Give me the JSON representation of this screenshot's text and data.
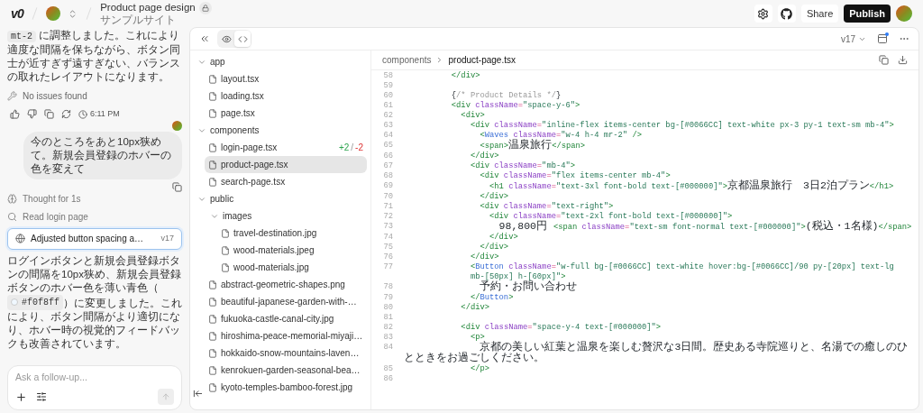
{
  "header": {
    "logo": "v0",
    "project_title": "Product page design",
    "subtitle": "サンプルサイト"
  },
  "top_actions": {
    "share": "Share",
    "publish": "Publish"
  },
  "chat": {
    "reply_segments": [
      {
        "kind": "code",
        "text": "mt-2"
      },
      {
        "kind": "text",
        "text": " に調整しました。これにより適度な間隔を保ちながら、ボタン同士が近すぎず遠すぎない、バランスの取れたレイアウトになります。"
      }
    ],
    "status": "No issues found",
    "time": "6:11 PM",
    "user_message": "今のところをあと10px狭めて。新規会員登録のホバーの色を変えて",
    "steps": [
      {
        "kind": "thought",
        "label": "Thought for 1s"
      },
      {
        "kind": "search",
        "label": "Read login page"
      }
    ],
    "version_card": {
      "title": "Adjusted button spacing a…",
      "version": "v17"
    },
    "final_segments": [
      {
        "kind": "text",
        "text": "ログインボタンと新規会員登録ボタンの間隔を10px狭め、新規会員登録ボタンのホバー色を薄い青色（"
      },
      {
        "kind": "color_code",
        "text": "#f0f8ff",
        "color": "#f0f8ff"
      },
      {
        "kind": "text",
        "text": "）に変更しました。これにより、ボタン間隔がより適切になり、ホバー時の視覚的フィードバックも改善されています。"
      }
    ],
    "input": {
      "placeholder": "Ask a follow-up..."
    }
  },
  "editor": {
    "version": "v17",
    "view_tabs": [
      {
        "kind": "preview",
        "selected": false
      },
      {
        "kind": "code",
        "selected": true
      }
    ],
    "tree": [
      {
        "kind": "folder",
        "name": "app",
        "expanded": true,
        "children": [
          {
            "kind": "file",
            "name": "layout.tsx",
            "selected": false
          },
          {
            "kind": "file",
            "name": "loading.tsx",
            "selected": false
          },
          {
            "kind": "file",
            "name": "page.tsx",
            "selected": false
          }
        ]
      },
      {
        "kind": "folder",
        "name": "components",
        "expanded": true,
        "children": [
          {
            "kind": "file",
            "name": "login-page.tsx",
            "selected": false,
            "diff": {
              "added": "+2",
              "sep": "/",
              "removed": "-2"
            }
          },
          {
            "kind": "file",
            "name": "product-page.tsx",
            "selected": true
          },
          {
            "kind": "file",
            "name": "search-page.tsx",
            "selected": false
          }
        ]
      },
      {
        "kind": "folder",
        "name": "public",
        "expanded": true,
        "children": [
          {
            "kind": "folder",
            "name": "images",
            "expanded": true,
            "children": [
              {
                "kind": "file",
                "name": "travel-destination.jpg",
                "selected": false
              },
              {
                "kind": "file",
                "name": "wood-materials.jpeg",
                "selected": false
              },
              {
                "kind": "file",
                "name": "wood-materials.jpg",
                "selected": false
              }
            ]
          },
          {
            "kind": "file",
            "name": "abstract-geometric-shapes.png",
            "selected": false
          },
          {
            "kind": "file",
            "name": "beautiful-japanese-garden-with-…",
            "selected": false
          },
          {
            "kind": "file",
            "name": "fukuoka-castle-canal-city.jpg",
            "selected": false
          },
          {
            "kind": "file",
            "name": "hiroshima-peace-memorial-miyaji…",
            "selected": false
          },
          {
            "kind": "file",
            "name": "hokkaido-snow-mountains-laven…",
            "selected": false
          },
          {
            "kind": "file",
            "name": "kenrokuen-garden-seasonal-bea…",
            "selected": false
          },
          {
            "kind": "file",
            "name": "kyoto-temples-bamboo-forest.jpg",
            "selected": false
          }
        ]
      }
    ],
    "breadcrumb": [
      "components",
      "product-page.tsx"
    ],
    "lines": [
      {
        "num": "58",
        "tokens": [
          {
            "kind": "tag",
            "text": "          </div>"
          }
        ]
      },
      {
        "num": "59"
      },
      {
        "num": "60",
        "tokens": [
          {
            "kind": "text",
            "text": "          {"
          },
          {
            "kind": "comment",
            "text": "/* Product Details */"
          },
          {
            "kind": "text",
            "text": "}"
          }
        ]
      },
      {
        "num": "61",
        "tokens": [
          {
            "kind": "tag",
            "text": "          <div"
          },
          {
            "kind": "attr",
            "text": " className"
          },
          {
            "kind": "eq",
            "text": "="
          },
          {
            "kind": "str",
            "text": "\"space-y-6\""
          },
          {
            "kind": "tag",
            "text": ">"
          }
        ]
      },
      {
        "num": "62",
        "tokens": [
          {
            "kind": "tag",
            "text": "            <div>"
          }
        ]
      },
      {
        "num": "63",
        "tokens": [
          {
            "kind": "tag",
            "text": "              <div"
          },
          {
            "kind": "attr",
            "text": " className"
          },
          {
            "kind": "eq",
            "text": "="
          },
          {
            "kind": "str",
            "text": "\"inline-flex items-center bg-[#0066CC] text-white px-3 py-1 text-sm mb-4\""
          },
          {
            "kind": "tag",
            "text": ">"
          }
        ]
      },
      {
        "num": "64",
        "tokens": [
          {
            "kind": "tag",
            "text": "                <"
          },
          {
            "kind": "comp",
            "text": "Waves"
          },
          {
            "kind": "attr",
            "text": " className"
          },
          {
            "kind": "eq",
            "text": "="
          },
          {
            "kind": "str",
            "text": "\"w-4 h-4 mr-2\""
          },
          {
            "kind": "tag",
            "text": " />"
          }
        ]
      },
      {
        "num": "65",
        "tokens": [
          {
            "kind": "tag",
            "text": "                <span>"
          },
          {
            "kind": "jp",
            "text": "温泉旅行"
          },
          {
            "kind": "tag",
            "text": "</span>"
          }
        ]
      },
      {
        "num": "66",
        "tokens": [
          {
            "kind": "tag",
            "text": "              </div>"
          }
        ]
      },
      {
        "num": "67",
        "tokens": [
          {
            "kind": "tag",
            "text": "              <div"
          },
          {
            "kind": "attr",
            "text": " className"
          },
          {
            "kind": "eq",
            "text": "="
          },
          {
            "kind": "str",
            "text": "\"mb-4\""
          },
          {
            "kind": "tag",
            "text": ">"
          }
        ]
      },
      {
        "num": "68",
        "tokens": [
          {
            "kind": "tag",
            "text": "                <div"
          },
          {
            "kind": "attr",
            "text": " className"
          },
          {
            "kind": "eq",
            "text": "="
          },
          {
            "kind": "str",
            "text": "\"flex items-center mb-4\""
          },
          {
            "kind": "tag",
            "text": ">"
          }
        ]
      },
      {
        "num": "69",
        "tokens": [
          {
            "kind": "tag",
            "text": "                  <h1"
          },
          {
            "kind": "attr",
            "text": " className"
          },
          {
            "kind": "eq",
            "text": "="
          },
          {
            "kind": "str",
            "text": "\"text-3xl font-bold text-[#000000]\""
          },
          {
            "kind": "tag",
            "text": ">"
          },
          {
            "kind": "jp",
            "text": "京都温泉旅行　3日2泊プラン"
          },
          {
            "kind": "tag",
            "text": "</h1>"
          }
        ]
      },
      {
        "num": "70",
        "tokens": [
          {
            "kind": "tag",
            "text": "                </div>"
          }
        ]
      },
      {
        "num": "71",
        "tokens": [
          {
            "kind": "tag",
            "text": "                <div"
          },
          {
            "kind": "attr",
            "text": " className"
          },
          {
            "kind": "eq",
            "text": "="
          },
          {
            "kind": "str",
            "text": "\"text-right\""
          },
          {
            "kind": "tag",
            "text": ">"
          }
        ]
      },
      {
        "num": "72",
        "tokens": [
          {
            "kind": "tag",
            "text": "                  <div"
          },
          {
            "kind": "attr",
            "text": " className"
          },
          {
            "kind": "eq",
            "text": "="
          },
          {
            "kind": "str",
            "text": "\"text-2xl font-bold text-[#000000]\""
          },
          {
            "kind": "tag",
            "text": ">"
          }
        ]
      },
      {
        "num": "73",
        "tokens": [
          {
            "kind": "jp",
            "text": "                    98,800円 "
          },
          {
            "kind": "tag",
            "text": "<span"
          },
          {
            "kind": "attr",
            "text": " className"
          },
          {
            "kind": "eq",
            "text": "="
          },
          {
            "kind": "str",
            "text": "\"text-sm font-normal text-[#000000]\""
          },
          {
            "kind": "tag",
            "text": ">"
          },
          {
            "kind": "jp",
            "text": "(税込・1名様)"
          },
          {
            "kind": "tag",
            "text": "</span>"
          }
        ]
      },
      {
        "num": "74",
        "tokens": [
          {
            "kind": "tag",
            "text": "                  </div>"
          }
        ]
      },
      {
        "num": "75",
        "tokens": [
          {
            "kind": "tag",
            "text": "                </div>"
          }
        ]
      },
      {
        "num": "76",
        "tokens": [
          {
            "kind": "tag",
            "text": "              </div>"
          }
        ]
      },
      {
        "num": "77",
        "tokens": [
          {
            "kind": "tag",
            "text": "              <"
          },
          {
            "kind": "comp",
            "text": "Button"
          },
          {
            "kind": "attr",
            "text": " className"
          },
          {
            "kind": "eq",
            "text": "="
          },
          {
            "kind": "str",
            "text": "\"w-full bg-[#0066CC] text-white hover:bg-[#0066CC]/90 py-[20px] text-lg"
          }
        ]
      },
      {
        "tokens": [
          {
            "kind": "str",
            "text": "              mb-[50px] h-[60px]\""
          },
          {
            "kind": "tag",
            "text": ">"
          }
        ]
      },
      {
        "num": "78",
        "tokens": [
          {
            "kind": "jp",
            "text": "                予約・お問い合わせ"
          }
        ]
      },
      {
        "num": "79",
        "tokens": [
          {
            "kind": "tag",
            "text": "              </"
          },
          {
            "kind": "comp",
            "text": "Button"
          },
          {
            "kind": "tag",
            "text": ">"
          }
        ]
      },
      {
        "num": "80",
        "tokens": [
          {
            "kind": "tag",
            "text": "            </div>"
          }
        ]
      },
      {
        "num": "81"
      },
      {
        "num": "82",
        "tokens": [
          {
            "kind": "tag",
            "text": "            <div"
          },
          {
            "kind": "attr",
            "text": " className"
          },
          {
            "kind": "eq",
            "text": "="
          },
          {
            "kind": "str",
            "text": "\"space-y-4 text-[#000000]\""
          },
          {
            "kind": "tag",
            "text": ">"
          }
        ]
      },
      {
        "num": "83",
        "tokens": [
          {
            "kind": "tag",
            "text": "              <p>"
          }
        ]
      },
      {
        "num": "84",
        "tokens": [
          {
            "kind": "jp",
            "text": "                京都の美しい紅葉と温泉を楽しむ贅沢な3日間。歴史ある寺院巡りと、名湯での癒しのひとときをお過ごしください。"
          }
        ]
      },
      {
        "num": "85",
        "tokens": [
          {
            "kind": "tag",
            "text": "              </p>"
          }
        ]
      },
      {
        "num": "86"
      }
    ]
  }
}
